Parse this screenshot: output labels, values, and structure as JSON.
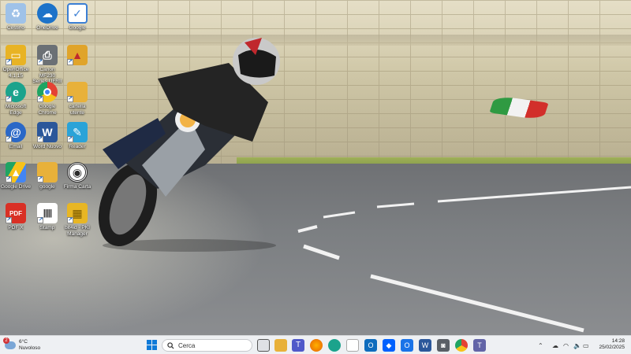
{
  "desktop": {
    "icons": [
      {
        "label": "Cestino",
        "icon": "recycle-bin-icon",
        "color": "#9fc2e8"
      },
      {
        "label": "OneDrive",
        "icon": "onedrive-icon",
        "color": "#1e73c9"
      },
      {
        "label": "Google",
        "icon": "google-docs-icon",
        "color": "#3b7fd4"
      },
      {
        "label": "OpenOffice 4.1.15",
        "icon": "openoffice-icon",
        "color": "#e8b324"
      },
      {
        "label": "Canon MF230 Series UFRII",
        "icon": "printer-icon",
        "color": "#6b7075"
      },
      {
        "label": "",
        "icon": "folder-red-icon",
        "color": "#e0a42a"
      },
      {
        "label": "Microsoft Edge",
        "icon": "edge-icon",
        "color": "#1ba38c"
      },
      {
        "label": "Google Chrome",
        "icon": "chrome-icon",
        "color": "#e44234"
      },
      {
        "label": "cartella utente",
        "icon": "folder-icon",
        "color": "#e8b13a"
      },
      {
        "label": "Email",
        "icon": "email-icon",
        "color": "#2a68c7"
      },
      {
        "label": "Word Nuovo",
        "icon": "word-icon",
        "color": "#2b579a"
      },
      {
        "label": "Reader",
        "icon": "reader-icon",
        "color": "#2aa3d8"
      },
      {
        "label": "Google Drive",
        "icon": "google-drive-icon",
        "color": "#1fa463"
      },
      {
        "label": "google",
        "icon": "folder-icon",
        "color": "#e8b13a"
      },
      {
        "label": "Firma Carta",
        "icon": "target-icon",
        "color": "#2b2b2b"
      },
      {
        "label": "PDF X",
        "icon": "pdf-icon",
        "color": "#d93025"
      },
      {
        "label": "Stamp",
        "icon": "barcode-icon",
        "color": "#3a3a3a"
      },
      {
        "label": "bit4id - PKI Manager",
        "icon": "smartcard-icon",
        "color": "#e8b624"
      }
    ]
  },
  "taskbar": {
    "weather": {
      "badge": "2",
      "temp": "6°C",
      "desc": "Nuvoloso"
    },
    "search_placeholder": "Cerca",
    "apps": [
      {
        "name": "task-view-icon",
        "color": "#3b3b3b"
      },
      {
        "name": "file-explorer-icon",
        "color": "#e8b13a"
      },
      {
        "name": "teams-icon",
        "color": "#5059c9"
      },
      {
        "name": "firefox-icon",
        "color": "#e66000"
      },
      {
        "name": "edge-icon",
        "color": "#1ba38c"
      },
      {
        "name": "store-icon",
        "color": "#3a86d6"
      },
      {
        "name": "outlook-icon",
        "color": "#0f6cbd"
      },
      {
        "name": "dropbox-icon",
        "color": "#0061fe"
      },
      {
        "name": "outlook-new-icon",
        "color": "#1a73e8"
      },
      {
        "name": "word-icon",
        "color": "#2b579a"
      },
      {
        "name": "camera-icon",
        "color": "#5a5f66"
      },
      {
        "name": "chrome-icon",
        "color": "#e44234"
      },
      {
        "name": "teams-work-icon",
        "color": "#6264a7"
      }
    ],
    "clock": {
      "time": "14:28",
      "date": "25/02/2025"
    }
  }
}
